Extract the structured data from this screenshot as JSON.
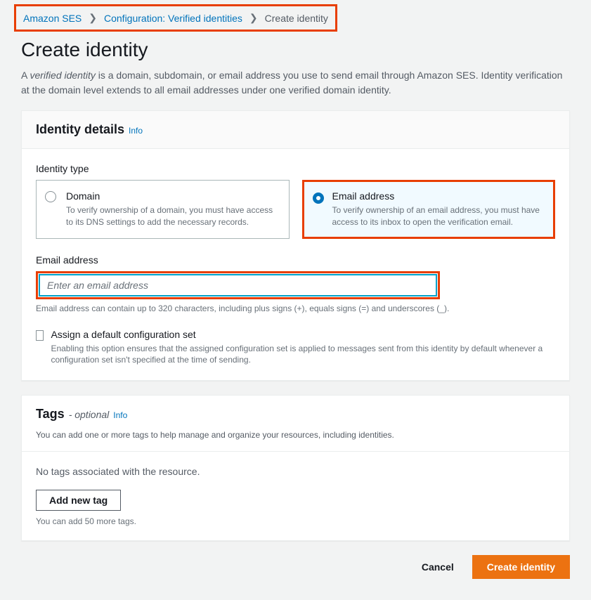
{
  "breadcrumb": {
    "items": [
      {
        "label": "Amazon SES"
      },
      {
        "label": "Configuration: Verified identities"
      }
    ],
    "current": "Create identity"
  },
  "page_title": "Create identity",
  "page_subtitle_prefix": "A ",
  "page_subtitle_em": "verified identity",
  "page_subtitle_rest": " is a domain, subdomain, or email address you use to send email through Amazon SES. Identity verification at the domain level extends to all email addresses under one verified domain identity.",
  "identity_panel": {
    "title": "Identity details",
    "info": "Info",
    "type_label": "Identity type",
    "domain": {
      "title": "Domain",
      "desc": "To verify ownership of a domain, you must have access to its DNS settings to add the necessary records."
    },
    "email": {
      "title": "Email address",
      "desc": "To verify ownership of an email address, you must have access to its inbox to open the verification email."
    },
    "email_field_label": "Email address",
    "email_placeholder": "Enter an email address",
    "email_hint": "Email address can contain up to 320 characters, including plus signs (+), equals signs (=) and underscores (_).",
    "configset_label": "Assign a default configuration set",
    "configset_desc": "Enabling this option ensures that the assigned configuration set is applied to messages sent from this identity by default whenever a configuration set isn't specified at the time of sending."
  },
  "tags_panel": {
    "title": "Tags",
    "suffix": "- optional",
    "info": "Info",
    "desc": "You can add one or more tags to help manage and organize your resources, including identities.",
    "empty": "No tags associated with the resource.",
    "add_button": "Add new tag",
    "limit": "You can add 50 more tags."
  },
  "actions": {
    "cancel": "Cancel",
    "create": "Create identity"
  }
}
